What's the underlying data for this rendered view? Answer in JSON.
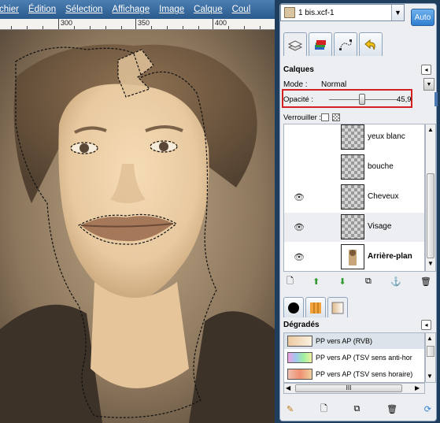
{
  "menu": {
    "items": [
      "chier",
      "Édition",
      "Sélection",
      "Affichage",
      "Image",
      "Calque",
      "Coul"
    ]
  },
  "ruler": {
    "labels": [
      "300",
      "350",
      "400"
    ]
  },
  "dock": {
    "image_select": {
      "value": "1 bis.xcf-1"
    },
    "auto_button": "Auto"
  },
  "layers_panel": {
    "title": "Calques",
    "mode_label": "Mode :",
    "mode_value": "Normal",
    "opacity_label": "Opacité :",
    "opacity_value": "45,9",
    "lock_label": "Verrouiller :",
    "layers": [
      {
        "name": "yeux blanc",
        "visible": false,
        "bold": false
      },
      {
        "name": "bouche",
        "visible": false,
        "bold": false
      },
      {
        "name": "Cheveux",
        "visible": true,
        "bold": false
      },
      {
        "name": "Visage",
        "visible": true,
        "bold": false
      },
      {
        "name": "Arrière-plan",
        "visible": true,
        "bold": true
      }
    ]
  },
  "gradients_panel": {
    "title": "Dégradés",
    "items": [
      {
        "name": "PP vers AP (RVB)",
        "selected": true
      },
      {
        "name": "PP vers AP (TSV sens anti-hor",
        "selected": false
      },
      {
        "name": "PP vers AP (TSV sens horaire)",
        "selected": false
      }
    ],
    "hscroll_label": "III"
  },
  "colors": {
    "selection_highlight": "#d42020",
    "accent_blue": "#2f7fd0",
    "dock_background": "#1f3d5c"
  }
}
